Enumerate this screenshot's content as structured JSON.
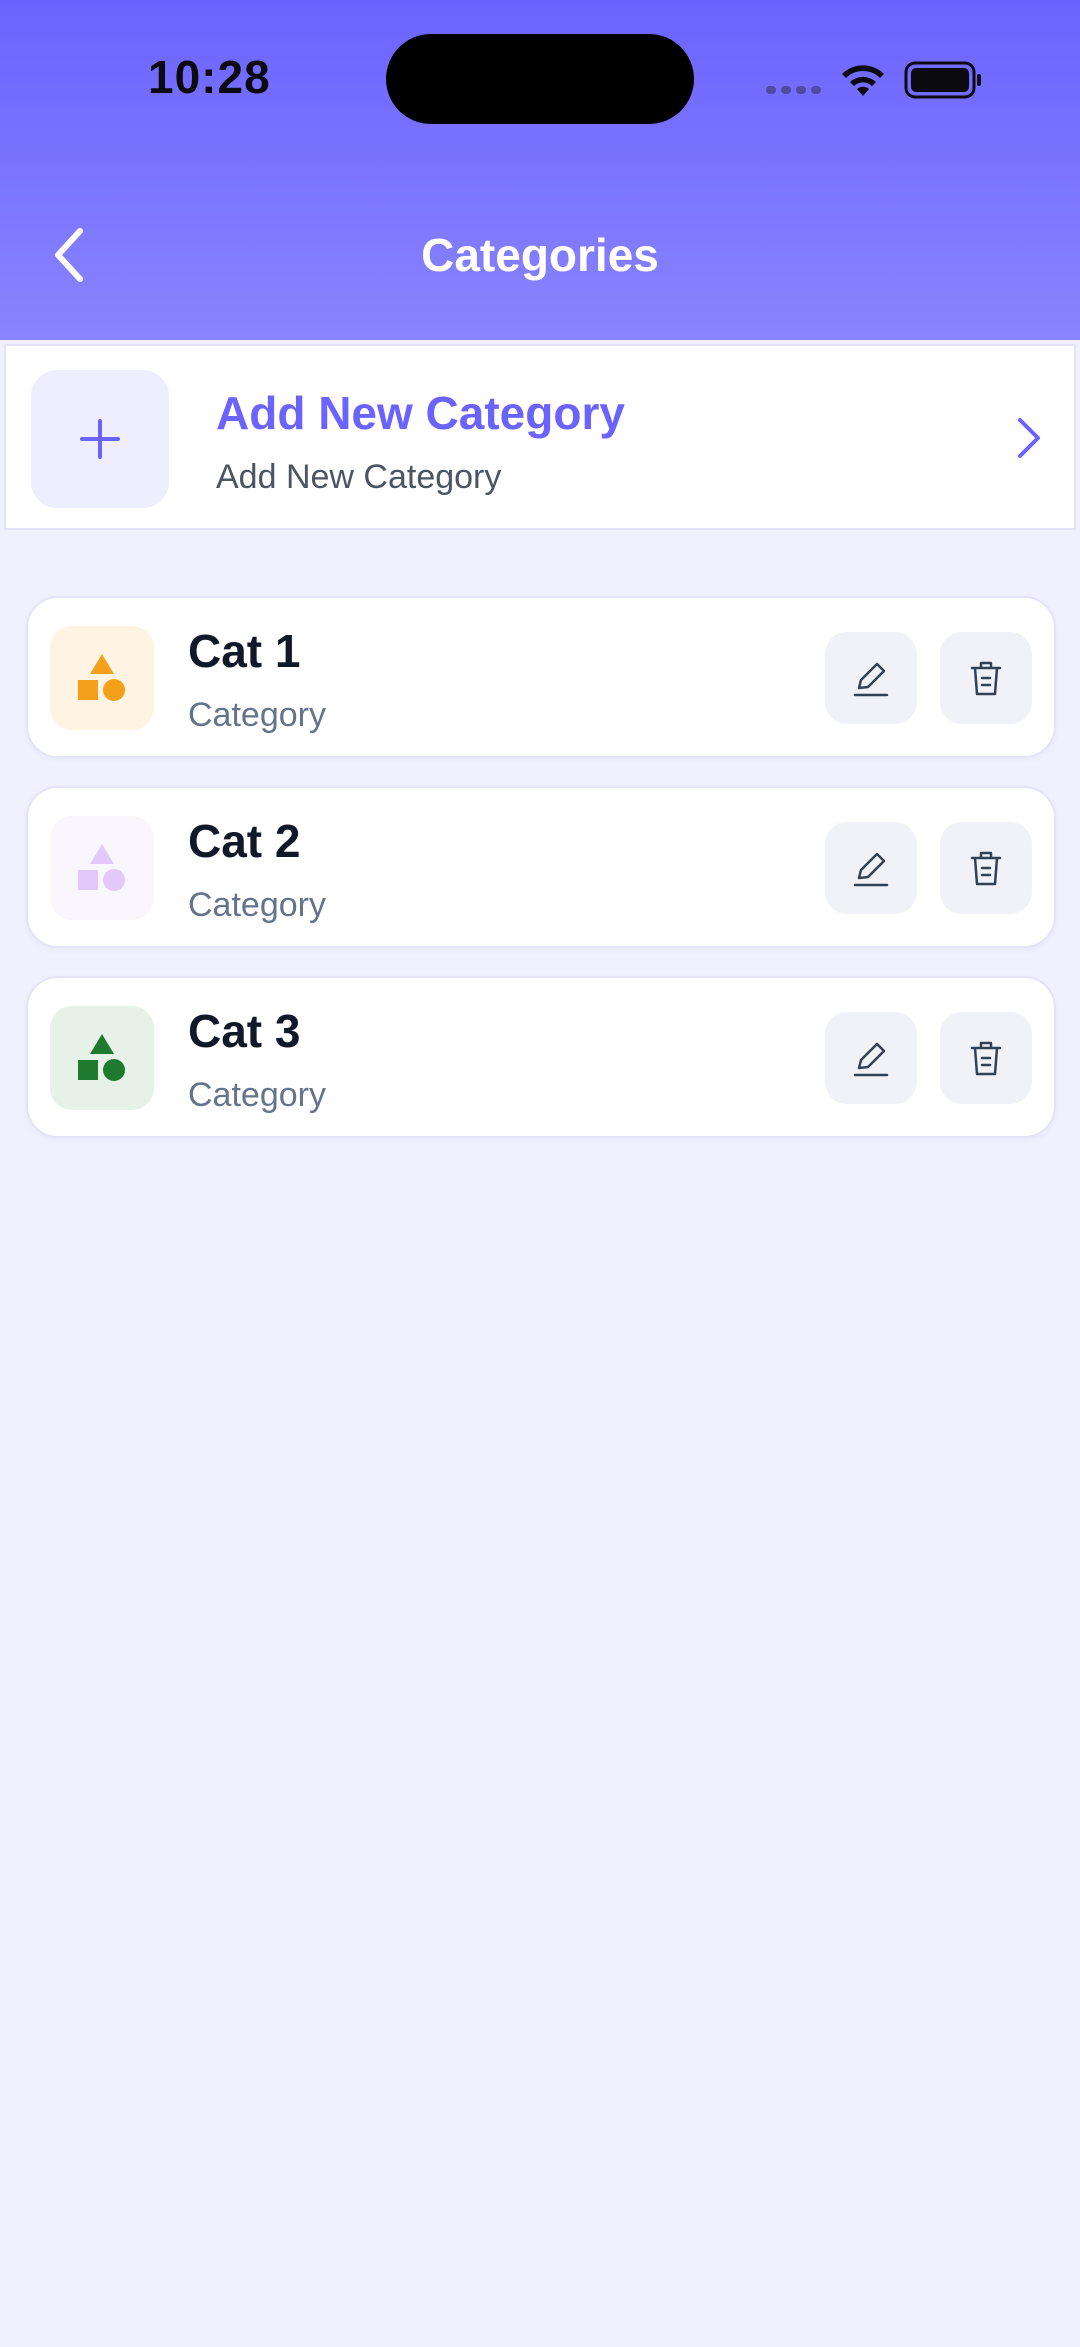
{
  "status_bar": {
    "time": "10:28"
  },
  "header": {
    "title": "Categories",
    "back_icon": "chevron-left-icon"
  },
  "add_category": {
    "title": "Add New Category",
    "subtitle": "Add New Category",
    "icon": "plus-icon",
    "accent": "#6C63FF"
  },
  "categories": [
    {
      "name": "Cat 1",
      "type": "Category",
      "icon_color": "#F5A01A",
      "icon_bg": "#FFF3E2"
    },
    {
      "name": "Cat 2",
      "type": "Category",
      "icon_color": "#E2C8FB",
      "icon_bg": "#FAF6FE"
    },
    {
      "name": "Cat 3",
      "type": "Category",
      "icon_color": "#1E7A2F",
      "icon_bg": "#E6F1E8"
    }
  ],
  "colors": {
    "header_gradient_start": "#6C63FF",
    "header_gradient_end": "#8A84FF",
    "background": "#F1F0FE"
  }
}
